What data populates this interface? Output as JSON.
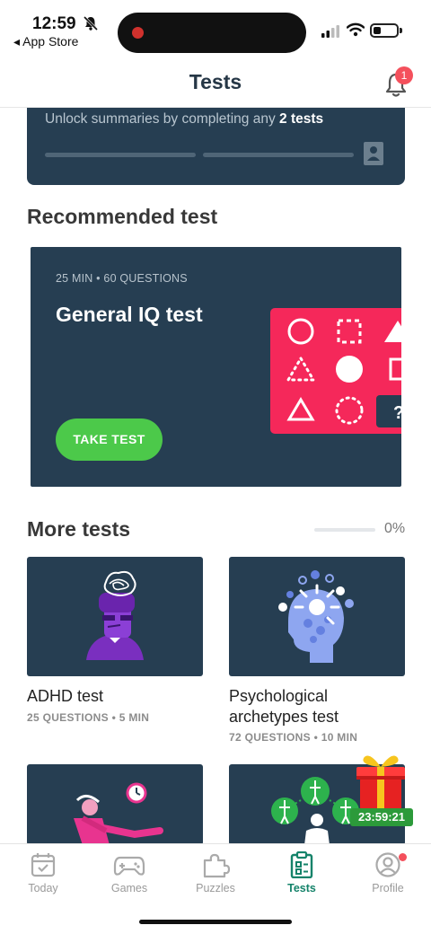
{
  "status_bar": {
    "time": "12:59",
    "back_label": "◂ App Store"
  },
  "header": {
    "title": "Tests",
    "notification_count": "1"
  },
  "progress_card": {
    "text_prefix": "Unlock summaries by completing any ",
    "text_bold": "2 tests",
    "steps_completed": 0,
    "steps_total": 2
  },
  "recommended": {
    "section_title": "Recommended test",
    "meta": "25 MIN • 60 QUESTIONS",
    "name": "General IQ test",
    "button_label": "TAKE TEST",
    "art_question_mark": "?"
  },
  "more_tests": {
    "section_title": "More tests",
    "progress_label": "0%",
    "progress_value": 0,
    "items": [
      {
        "name": "ADHD test",
        "meta": "25 QUESTIONS • 5 MIN"
      },
      {
        "name": "Psychological archetypes test",
        "meta": "72 QUESTIONS • 10 MIN"
      }
    ]
  },
  "gift": {
    "timer": "23:59:21"
  },
  "tabs": [
    {
      "label": "Today",
      "icon": "calendar-icon",
      "active": false
    },
    {
      "label": "Games",
      "icon": "gamepad-icon",
      "active": false
    },
    {
      "label": "Puzzles",
      "icon": "puzzle-icon",
      "active": false
    },
    {
      "label": "Tests",
      "icon": "clipboard-icon",
      "active": true
    },
    {
      "label": "Profile",
      "icon": "profile-icon",
      "active": false
    }
  ],
  "colors": {
    "card_bg": "#263e52",
    "accent_green": "#4cc94a",
    "active_tab": "#15836a",
    "badge_red": "#f4505c",
    "iq_pink": "#f5285a"
  }
}
